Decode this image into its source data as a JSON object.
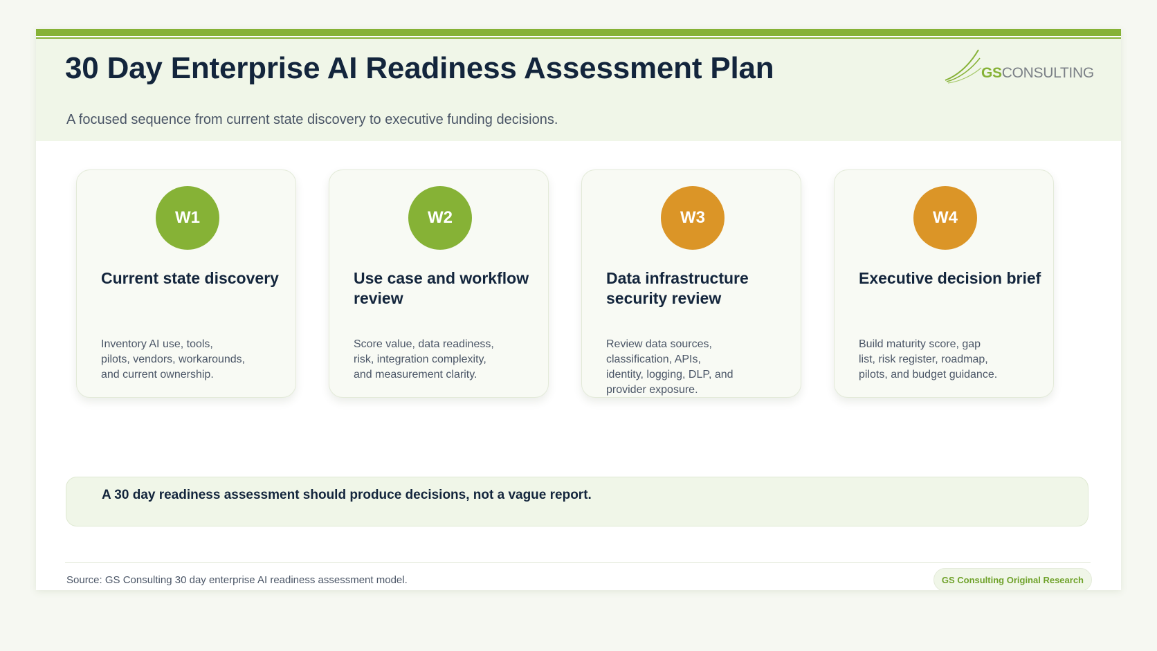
{
  "header": {
    "title": "30 Day Enterprise AI Readiness Assessment Plan",
    "subtitle": "A focused sequence from current state discovery to executive funding decisions."
  },
  "logo": {
    "brand_bold": "GS",
    "brand_rest": "CONSULTING"
  },
  "phases": [
    {
      "badge": "W1",
      "badge_color": "#86b236",
      "title": "Current state discovery",
      "lines": [
        "Inventory AI use, tools,",
        "pilots, vendors, workarounds,",
        "and current ownership."
      ]
    },
    {
      "badge": "W2",
      "badge_color": "#86b236",
      "title": "Use case and workflow review",
      "lines": [
        "Score value, data readiness,",
        "risk, integration complexity,",
        "and measurement clarity."
      ]
    },
    {
      "badge": "W3",
      "badge_color": "#db9527",
      "title": "Data infrastructure security review",
      "lines": [
        "Review data sources,",
        "classification, APIs,",
        "identity, logging, DLP, and",
        "provider exposure."
      ]
    },
    {
      "badge": "W4",
      "badge_color": "#db9527",
      "title": "Executive decision brief",
      "lines": [
        "Build maturity score, gap",
        "list, risk register, roadmap,",
        "pilots, and budget guidance."
      ]
    }
  ],
  "callout": {
    "text": "A 30 day readiness assessment should produce decisions, not a vague report."
  },
  "footer": {
    "source": "Source: GS Consulting 30 day enterprise AI readiness assessment model.",
    "tag": "GS Consulting Original Research"
  },
  "colors": {
    "accent_green": "#86b236",
    "accent_orange": "#db9527",
    "navy": "#13253c"
  }
}
